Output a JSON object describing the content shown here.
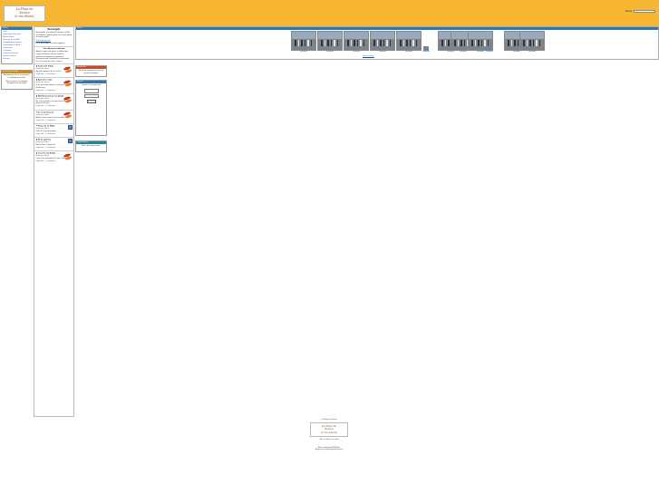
{
  "header": {
    "logo_lines": [
      "La Plaça de",
      "Xeraco",
      "(e res Ahora)"
    ],
    "search_label": "Buscar"
  },
  "left_menu": {
    "title": "Menú",
    "items": [
      "Inici",
      "Informació General",
      "Meteo Flash",
      "Normes de la Web",
      "Estadístiques Fòrum",
      "Recomanar la Web",
      "Enquestes",
      "Contacte",
      "Galeria de Fotos",
      "Enviar notícia",
      "Fòrums"
    ]
  },
  "left_box": {
    "title": "Qui està en línia",
    "text": "Actualment hi ha 3 visitants i 0 membres en línia.",
    "text2": "Pots crear-te un compte d'usuari fent clic aquí"
  },
  "middle": {
    "title": "Benvinguts",
    "intro": "Benvinguts a la plaça de Xeraco, un lloc on debatre i opinar sobre tot el que passa al nostre poble.",
    "link": "Vull registrar-me!",
    "intro2": "Per a participar cal estar registrat.",
    "section_title": "Les darreres notícies",
    "section_text": "Aquest espai està obert a tothom que vulga col·laborar. Enviar notícies, opinions, fotografies o qualsevol informació que considereu interessant per a la resta de veïns i veïnes.",
    "posts": [
      {
        "title": "Festa del Poble",
        "meta": "Enviat per admin",
        "body": "Agenda completa de les festes.",
        "foot": "Llegir més... | Comentaris"
      },
      {
        "title": "Aprovat el pla",
        "meta": "Enviat per admin",
        "body": "El ple municipal aprova el pla general d'ordenació.",
        "foot": "Llegir més... | Comentaris"
      },
      {
        "title": "Manifestació per la platja",
        "meta": "Enviat per admin",
        "body": "Els veïns reclamen la regeneració de la platja de Xeraco.",
        "foot": "Llegir més... | Comentaris"
      },
      {
        "title": "Ja és primavera",
        "meta": "Enviat per admin",
        "body": "Arriba el bon temps al nostre poble.",
        "foot": "Llegir més... | Comentaris"
      },
      {
        "title": "Fotos de la Mitja",
        "meta": "Enviat per admin",
        "body": "Fotos de la mitja marató.",
        "foot": "Llegir més... | Comentaris"
      },
      {
        "title": "Nova galeria",
        "meta": "Enviat per admin",
        "body": "Noves fotos a la galeria.",
        "foot": "Llegir més... | Comentaris"
      },
      {
        "title": "Concert de Nadal",
        "meta": "Enviat per admin",
        "body": "Concert de la banda al Centre Cultural.",
        "foot": "Llegir més... | Comentaris"
      }
    ]
  },
  "right_boxes": [
    {
      "title": "Enquesta",
      "text": "No hi ha enquestes actives en este moment."
    },
    {
      "title": "Entrar",
      "text": "Usuari / Contrasenya"
    },
    {
      "title": "Comentaris",
      "text": "No hi ha comentaris."
    }
  ],
  "gallery": {
    "title": "Fotos",
    "items": [
      "Fotografia",
      "Fotografia",
      "Fotografia",
      "Fotografia",
      "Fotografia",
      "Fotografia",
      "Fotografia",
      "Fotografia",
      "Fotografia",
      "Fotografia",
      "Fotografia",
      "Fotografia"
    ],
    "more_link": "Totes les fotos"
  },
  "footer": {
    "line1": "La Plaça de Xeraco",
    "line2": "Tots els drets reservats",
    "line3": "Web creada amb PHP-Nuke",
    "line4": "Pàgina generada automàticament"
  },
  "colors": {
    "topbar": "#f7b733",
    "accent": "#2b76b4"
  }
}
